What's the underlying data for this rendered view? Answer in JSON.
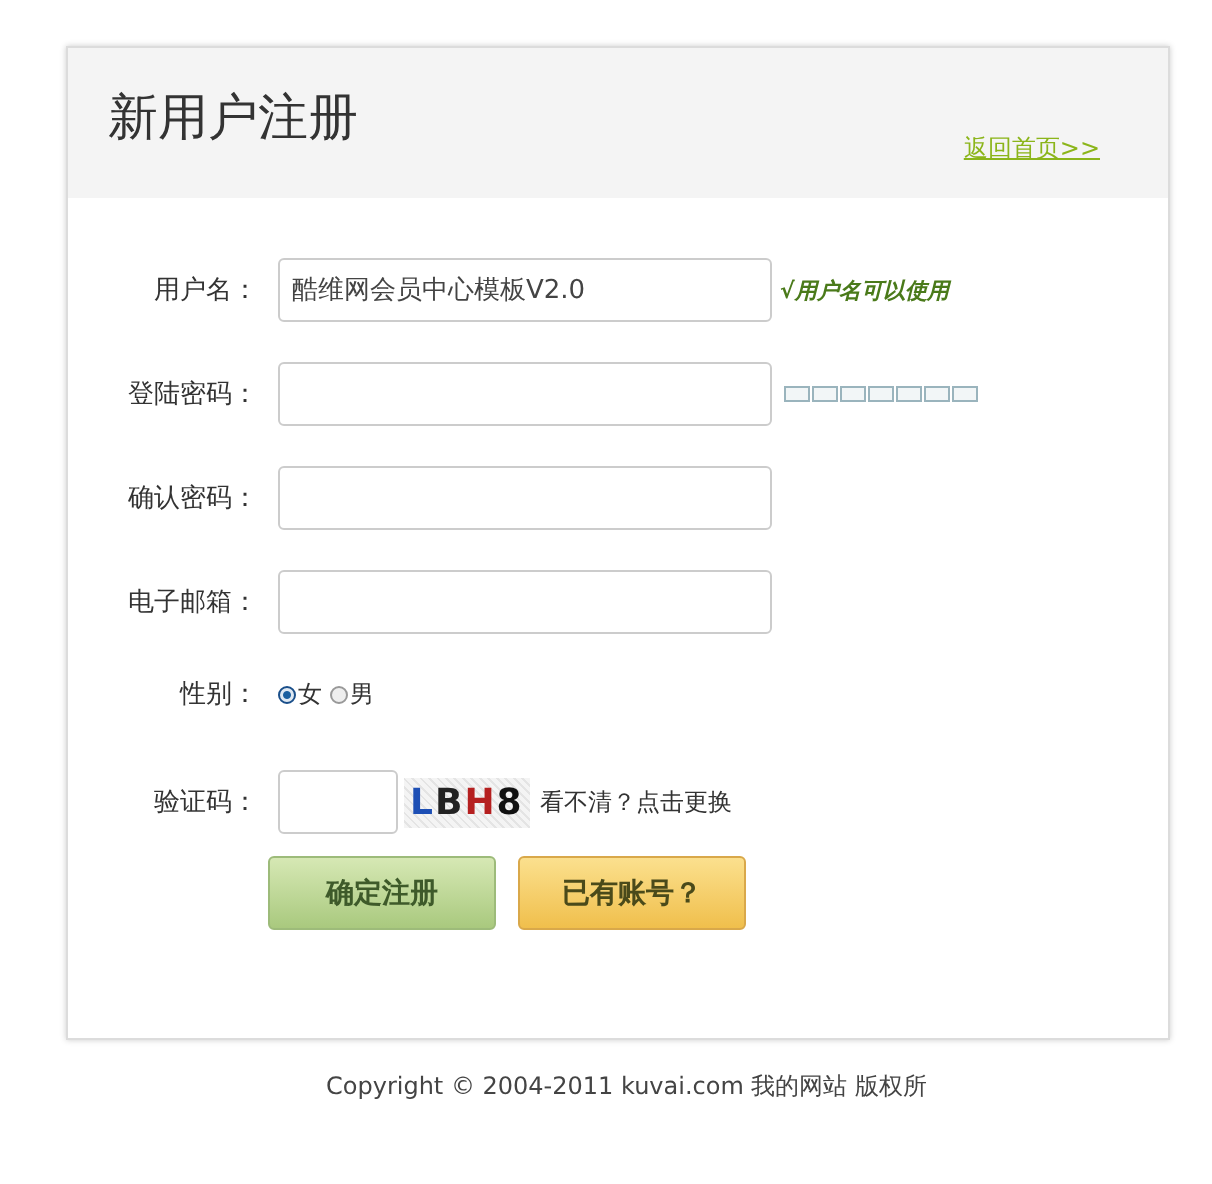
{
  "title": "新用户注册",
  "back_link": "返回首页>>",
  "fields": [
    {
      "kind": "text",
      "label": "用户名：",
      "value": "酷维网会员中心模板V2.0",
      "hint": "√用户名可以使用"
    },
    {
      "kind": "password",
      "label": "登陆密码：",
      "strength_meter": true
    },
    {
      "kind": "password",
      "label": "确认密码："
    },
    {
      "kind": "text",
      "label": "电子邮箱："
    }
  ],
  "gender": {
    "label": "性别：",
    "options": [
      {
        "label": "女",
        "selected": true
      },
      {
        "label": "男",
        "selected": false
      }
    ]
  },
  "captcha": {
    "label": "验证码：",
    "code": "LBH8",
    "refresh": "看不清？点击更换"
  },
  "buttons": [
    {
      "kind": "primary",
      "label": "确定注册"
    },
    {
      "kind": "secondary",
      "label": "已有账号？"
    }
  ],
  "footer": "Copyright © 2004-2011 kuvai.com 我的网站 版权所"
}
